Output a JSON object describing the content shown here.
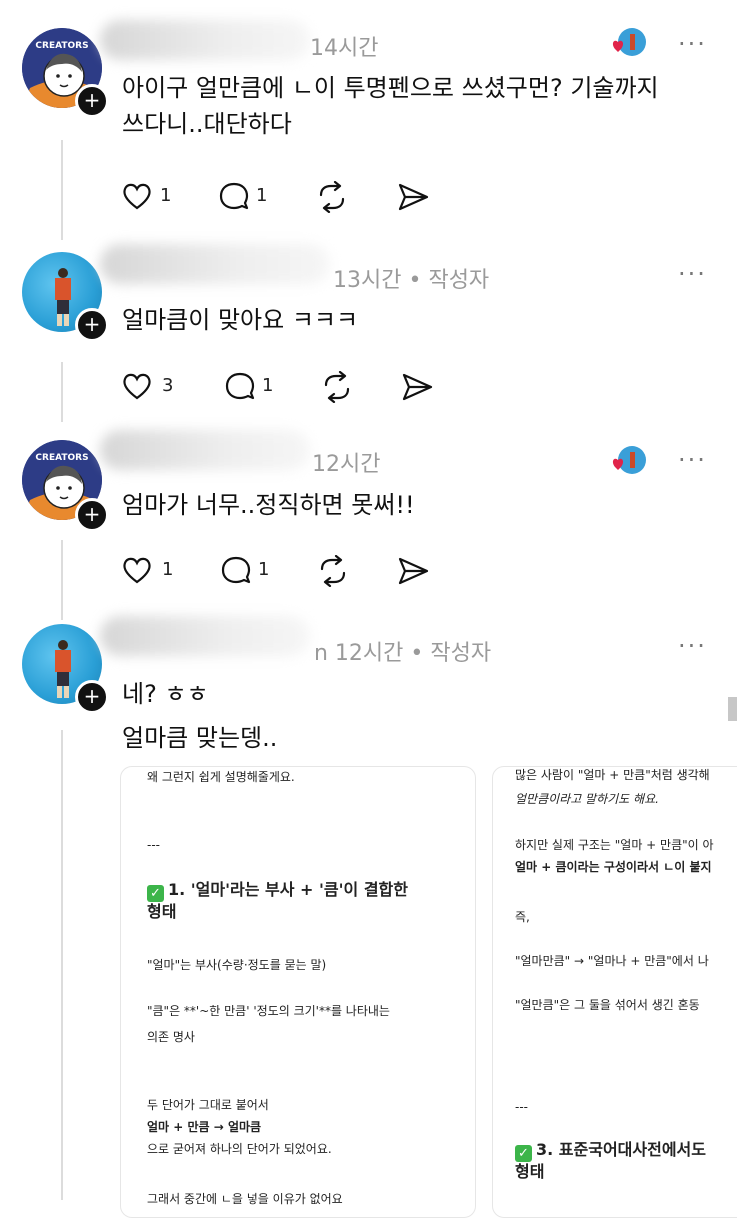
{
  "comments": [
    {
      "time": "14시간",
      "author_tag": "",
      "lines": [
        "아이구 얼만큼에 ㄴ이 투명펜으로 쓰셨구먼? 기술까지",
        "쓰다니..대단하다"
      ],
      "likes": "1",
      "replies": "1",
      "avatar": "creators-avatar",
      "liked_by_author": true
    },
    {
      "time": "13시간",
      "author_tag": "• 작성자",
      "lines": [
        "얼마큼이 맞아요 ㅋㅋㅋ"
      ],
      "likes": "3",
      "replies": "1",
      "avatar": "photo-avatar",
      "liked_by_author": false
    },
    {
      "time": "12시간",
      "author_tag": "",
      "lines": [
        "엄마가 너무..정직하면 못써!!"
      ],
      "likes": "1",
      "replies": "1",
      "avatar": "creators-avatar",
      "liked_by_author": true
    },
    {
      "time": "n 12시간",
      "author_tag": "• 작성자",
      "lines": [
        "네? ㅎㅎ",
        "얼마큼 맞는뎅.."
      ],
      "avatar": "photo-avatar",
      "liked_by_author": false
    }
  ],
  "more_label": "···",
  "avatar_badge": "CREATORS",
  "plus_label": "+",
  "card_left": {
    "lines": [
      "왜 그런지 쉽게 설명해줄게요.",
      "---",
      "1. '얼마'라는 부사 + '큼'이 결합한",
      "형태",
      "\"얼마\"는 부사(수량·정도를 묻는 말)",
      "\"큼\"은 **'~한 만큼' '정도의 크기'**를 나타내는",
      "의존 명사",
      "두 단어가 그대로 붙어서",
      "얼마 + 만큼 → 얼마큼",
      "으로 굳어져 하나의 단어가 되었어요.",
      "그래서 중간에 ㄴ을 넣을 이유가 없어요"
    ]
  },
  "card_right": {
    "lines": [
      "많은 사람이 \"얼마 + 만큼\"처럼 생각해",
      "얼만큼이라고 말하기도 해요.",
      "하지만 실제 구조는 \"얼마 + 만큼\"이 아",
      "얼마 + 큼이라는 구성이라서 ㄴ이 붙지",
      "즉,",
      "\"얼마만큼\" → \"얼마나 + 만큼\"에서 나",
      "\"얼만큼\"은 그 둘을 섞어서 생긴 혼동",
      "---",
      "3. 표준국어대사전에서도",
      "형태"
    ]
  },
  "colors": {
    "accent_green": "#3cb54a",
    "heart_red": "#e0244a",
    "avatar_navy": "#2d3c86"
  },
  "icons": [
    "heart-icon",
    "comment-icon",
    "repost-icon",
    "share-icon",
    "more-icon",
    "plus-icon"
  ]
}
